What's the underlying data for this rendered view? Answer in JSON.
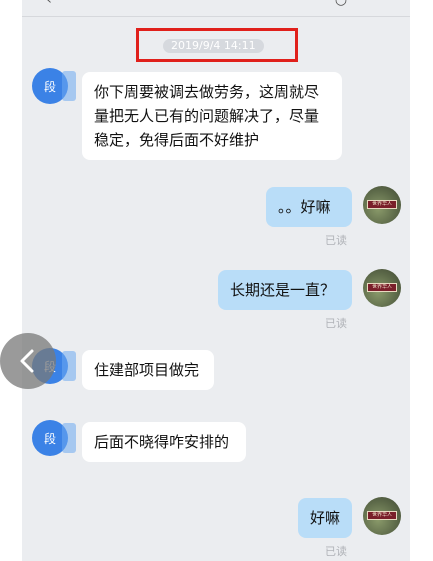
{
  "conversation": {
    "timestamp": "2019/9/4 14:11",
    "contact_avatar_text": "段",
    "self_avatar_sign_text": "世界华人",
    "read_label": "已读",
    "messages": [
      {
        "side": "left",
        "text": "你下周要被调去做劳务，这周就尽量把无人已有的问题解决了，尽量稳定，免得后面不好维护"
      },
      {
        "side": "right",
        "text": "。。好嘛"
      },
      {
        "side": "right",
        "text": "长期还是一直？"
      },
      {
        "side": "left",
        "text": "住建部项目做完"
      },
      {
        "side": "left",
        "text": "后面不晓得咋安排的"
      },
      {
        "side": "right",
        "text": "好嘛"
      }
    ]
  },
  "icons": {
    "back": "chevron-left-icon",
    "top_left": "back-arrow-icon",
    "top_right": "more-icon"
  },
  "colors": {
    "highlight_box": "#e0201b",
    "contact_avatar": "#3b82e6",
    "self_bubble": "#b9ddf8",
    "background": "#ebedf0"
  }
}
